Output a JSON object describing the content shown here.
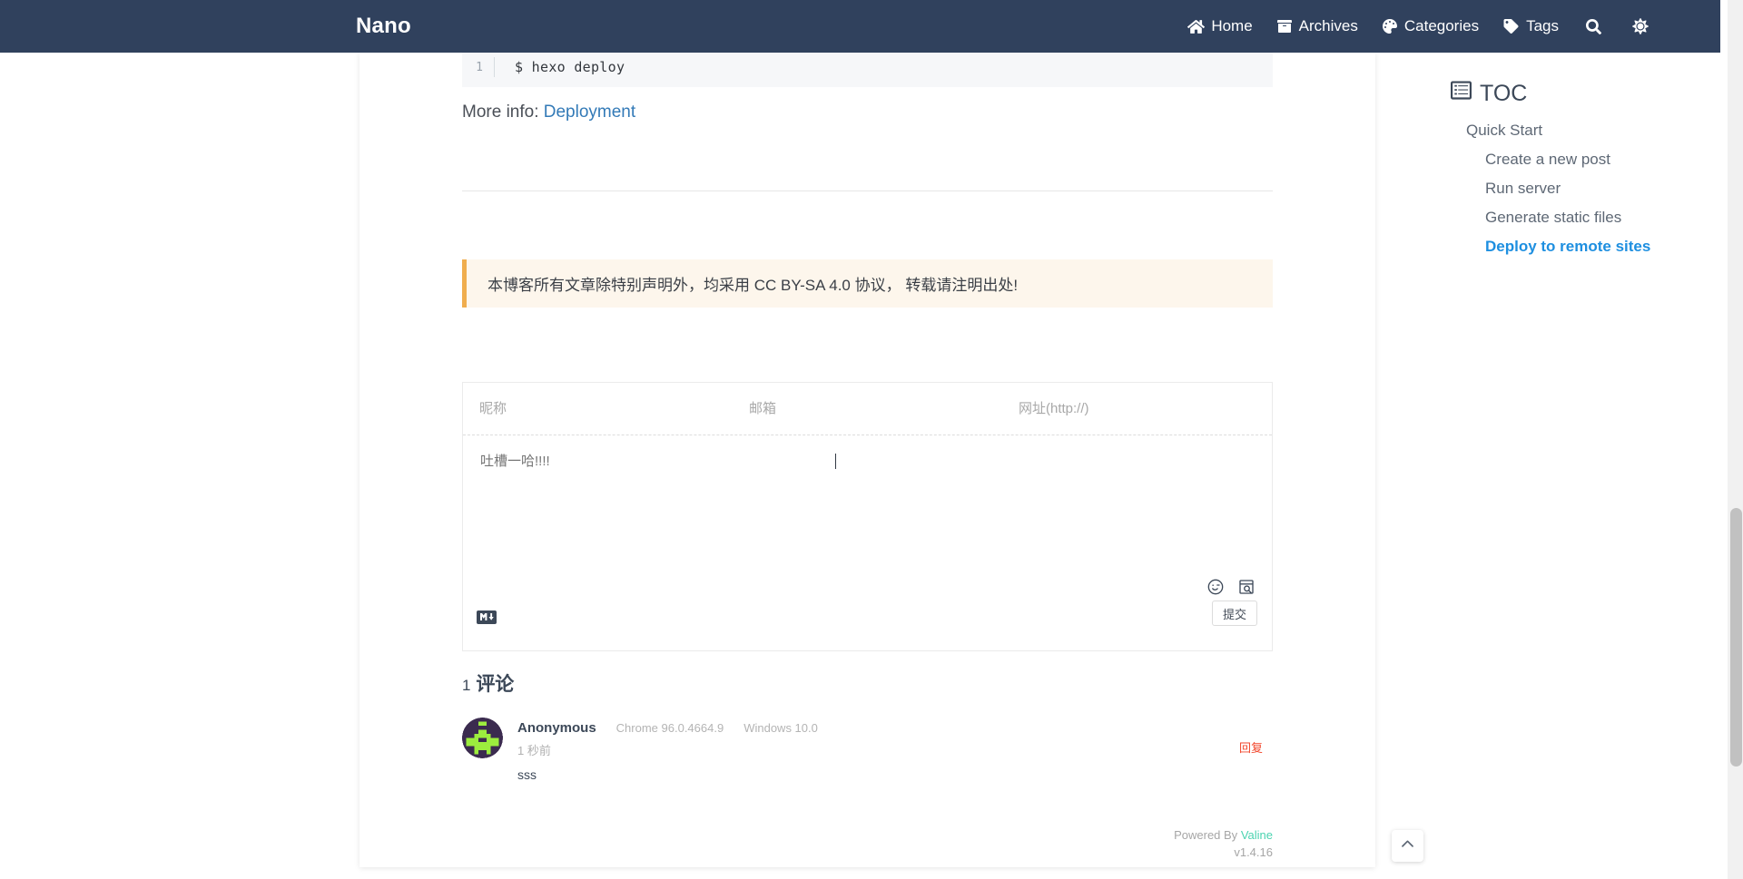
{
  "navbar": {
    "brand": "Nano",
    "items": [
      {
        "label": "Home",
        "icon": "home-icon"
      },
      {
        "label": "Archives",
        "icon": "archive-box-icon"
      },
      {
        "label": "Categories",
        "icon": "grid-squares-icon"
      },
      {
        "label": "Tags",
        "icon": "tag-icon"
      }
    ],
    "search_icon": "search-icon",
    "theme_icon": "sun-icon"
  },
  "article": {
    "code": {
      "line_number": "1",
      "text": "$ hexo deploy"
    },
    "more_info_prefix": "More info:",
    "more_info_link": "Deployment",
    "license_notice": "本博客所有文章除特别声明外，均采用 CC BY-SA 4.0 协议， 转载请注明出处!"
  },
  "comment_form": {
    "nickname_placeholder": "昵称",
    "email_placeholder": "邮箱",
    "website_placeholder": "网址(http://)",
    "nickname_value": "",
    "email_value": "",
    "website_value": "",
    "textarea_placeholder": "吐槽一哈!!!!",
    "textarea_value": "",
    "emoji_icon": "wink-smiley-icon",
    "preview_icon": "preview-magnifier-icon",
    "markdown_badge": "M↓",
    "submit_label": "提交"
  },
  "comments": {
    "count_number": "1",
    "count_label": "评论",
    "list": [
      {
        "author": "Anonymous",
        "browser": "Chrome 96.0.4664.9",
        "os": "Windows 10.0",
        "time": "1 秒前",
        "reply_label": "回复",
        "body": "sss",
        "avatar_bg": "#3b2b4f",
        "avatar_fg": "#9ced3e"
      }
    ],
    "powered_by_prefix": "Powered By",
    "powered_by_name": "Valine",
    "version": "v1.4.16"
  },
  "toc": {
    "title": "TOC",
    "icon": "list-lines-icon",
    "items": [
      {
        "label": "Quick Start",
        "level": 1,
        "active": false
      },
      {
        "label": "Create a new post",
        "level": 2,
        "active": false
      },
      {
        "label": "Run server",
        "level": 2,
        "active": false
      },
      {
        "label": "Generate static files",
        "level": 2,
        "active": false
      },
      {
        "label": "Deploy to remote sites",
        "level": 2,
        "active": true
      }
    ]
  },
  "theme": {
    "navbar_bg": "#30415d",
    "accent_blue": "#1e8fe0",
    "link_blue": "#337ab7",
    "notice_bg": "#fdf6ec",
    "notice_border": "#f0ad4e",
    "reply_red": "#f2462b",
    "valine_green": "#4bd3b0"
  },
  "controls": {
    "back_to_top": "back-to-top-icon"
  }
}
